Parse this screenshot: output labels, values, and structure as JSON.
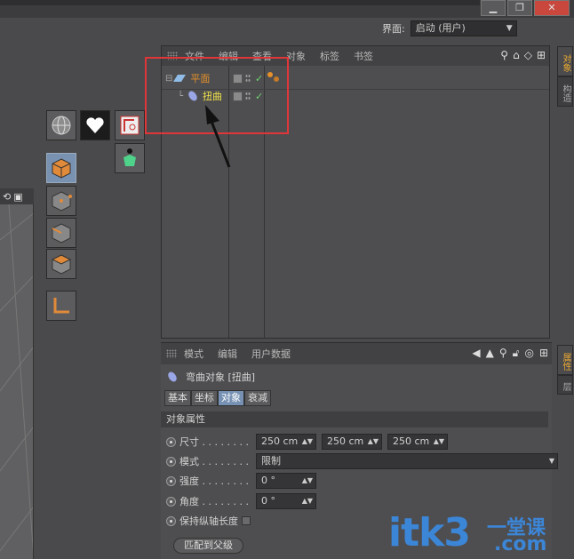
{
  "window": {
    "min_symbol": "▁",
    "max_symbol": "❐",
    "close_symbol": "✕"
  },
  "layout": {
    "label": "界面:",
    "value": "启动 (用户)"
  },
  "object_manager": {
    "menu": [
      "文件",
      "编辑",
      "查看",
      "对象",
      "标签",
      "书签"
    ],
    "objects": [
      {
        "name": "平面",
        "color": "#e5902a",
        "icon": "plane-icon"
      },
      {
        "name": "扭曲",
        "color": "#f2e34a",
        "icon": "bend-icon"
      }
    ]
  },
  "right_tabs": {
    "top": [
      "对象",
      "构造"
    ],
    "bottom": [
      "属性",
      "层"
    ]
  },
  "attribute_manager": {
    "menu": [
      "模式",
      "编辑",
      "用户数据"
    ],
    "title": "弯曲对象 [扭曲]",
    "tabs": [
      "基本",
      "坐标",
      "对象",
      "衰减"
    ],
    "active_tab": "对象",
    "section": "对象属性",
    "props": {
      "size_label": "尺寸 . . . . . . . .",
      "size_values": [
        "250 cm",
        "250 cm",
        "250 cm"
      ],
      "mode_label": "模式 . . . . . . . .",
      "mode_value": "限制",
      "strength_label": "强度 . . . . . . . .",
      "strength_value": "0 °",
      "angle_label": "角度 . . . . . . . .",
      "angle_value": "0 °",
      "keep_length_label": "保持纵轴长度"
    },
    "button_label": "匹配到父级"
  },
  "watermark": {
    "main": "itk3",
    "sub": "一堂课",
    "com": ".com"
  },
  "colors": {
    "annotation_red": "#e0363a",
    "tab_active": "#7691b3",
    "watermark_blue": "#3c86d8"
  }
}
